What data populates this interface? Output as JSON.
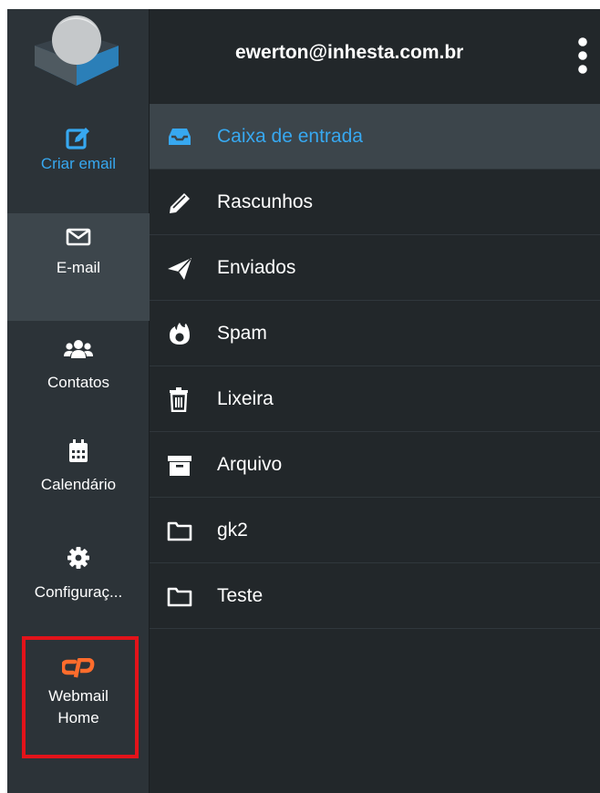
{
  "header": {
    "account": "ewerton@inhesta.com.br",
    "menu_icon": "vertical-dots-icon"
  },
  "sidebar": {
    "items": [
      {
        "id": "compose",
        "label": "Criar email",
        "icon": "pencil-square-icon",
        "color": "#37a8f0"
      },
      {
        "id": "mail",
        "label": "E-mail",
        "icon": "envelope-icon",
        "selected": true
      },
      {
        "id": "contacts",
        "label": "Contatos",
        "icon": "users-icon"
      },
      {
        "id": "calendar",
        "label": "Calendário",
        "icon": "calendar-icon"
      },
      {
        "id": "settings",
        "label": "Configuraç...",
        "icon": "gear-icon"
      },
      {
        "id": "cpanel",
        "label_line1": "Webmail",
        "label_line2": "Home",
        "icon": "cpanel-logo-icon",
        "highlight": "#e3131a"
      }
    ]
  },
  "folders": [
    {
      "name": "Caixa de entrada",
      "icon": "inbox-icon",
      "selected": true
    },
    {
      "name": "Rascunhos",
      "icon": "pencil-icon"
    },
    {
      "name": "Enviados",
      "icon": "paper-plane-icon"
    },
    {
      "name": "Spam",
      "icon": "fire-icon"
    },
    {
      "name": "Lixeira",
      "icon": "trash-icon"
    },
    {
      "name": "Arquivo",
      "icon": "archive-box-icon"
    },
    {
      "name": "gk2",
      "icon": "folder-icon"
    },
    {
      "name": "Teste",
      "icon": "folder-icon"
    }
  ],
  "colors": {
    "accent": "#37a8f0",
    "cpanel_orange": "#ff6c2c",
    "highlight_red": "#e3131a"
  }
}
